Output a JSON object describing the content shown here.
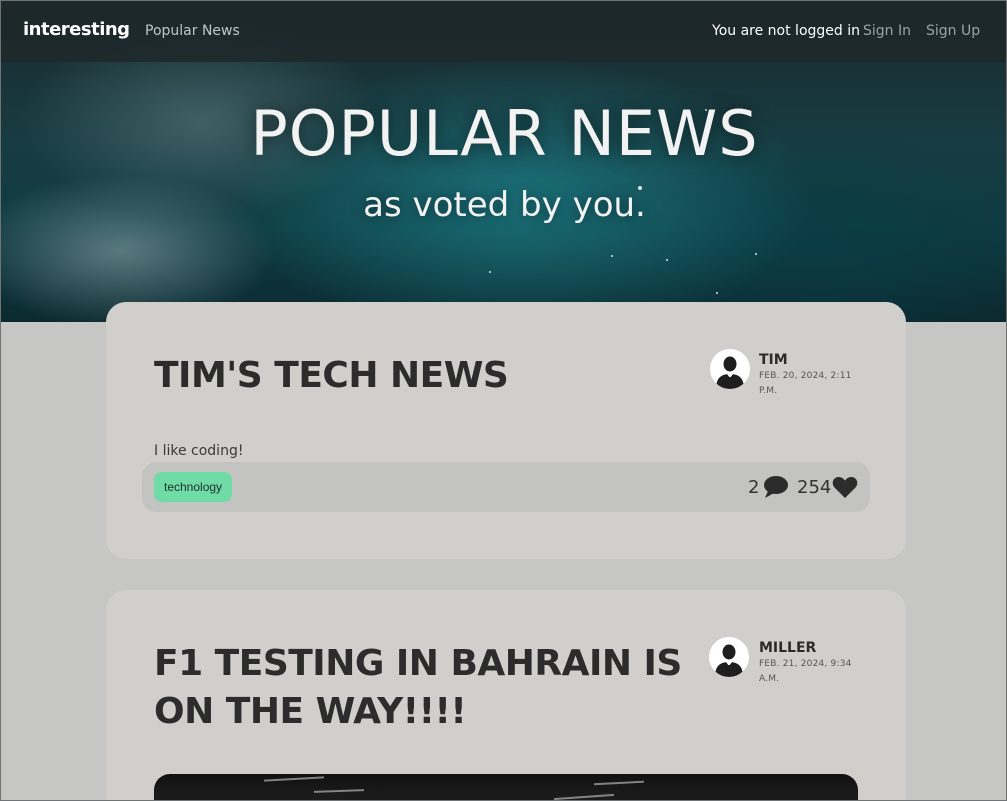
{
  "nav": {
    "brand": "interesting",
    "popular_link": "Popular News",
    "status": "You are not logged in",
    "sign_in": "Sign In",
    "sign_up": "Sign Up"
  },
  "hero": {
    "title": "POPULAR NEWS",
    "subtitle": "as voted by you."
  },
  "posts": [
    {
      "title": "TIM'S TECH NEWS",
      "author": "TIM",
      "date": "FEB. 20, 2024, 2:11 P.M.",
      "excerpt": "I like coding!",
      "tag": "technology",
      "comments": "2",
      "likes": "254"
    },
    {
      "title": "F1 TESTING IN BAHRAIN IS ON THE WAY!!!!",
      "author": "MILLER",
      "date": "FEB. 21, 2024, 9:34 A.M."
    }
  ],
  "colors": {
    "tag_bg": "#6fdca7",
    "card_bg": "#d0cfcc",
    "page_bg": "#c6c6c5"
  },
  "icons": {
    "comment": "speech-bubble-icon",
    "like": "heart-icon",
    "avatar": "person-silhouette-icon"
  }
}
